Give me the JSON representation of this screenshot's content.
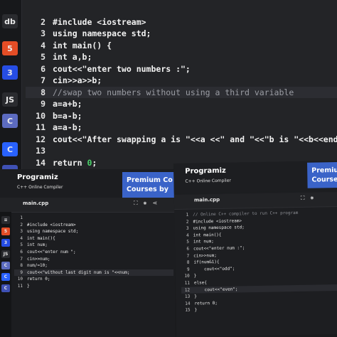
{
  "top_editor": {
    "sidebar_icons": [
      {
        "name": "database-icon",
        "bg": "#2a2b2f",
        "glyph": "db"
      },
      {
        "name": "html5-icon",
        "bg": "#e44d26",
        "glyph": "5"
      },
      {
        "name": "css3-icon",
        "bg": "#264de4",
        "glyph": "3"
      },
      {
        "name": "js-icon",
        "bg": "#2a2b2f",
        "glyph": "JS"
      },
      {
        "name": "c-lang-icon",
        "bg": "#5c6bc0",
        "glyph": "C"
      },
      {
        "name": "cpp-lang-icon",
        "bg": "#2962ff",
        "glyph": "C"
      },
      {
        "name": "csharp-icon",
        "bg": "#3f51b5",
        "glyph": "C#"
      }
    ],
    "lines": [
      {
        "num": "",
        "parts": [
          {
            "t": "",
            "c": ""
          }
        ]
      },
      {
        "num": "2",
        "parts": [
          {
            "t": "#include <iostream>",
            "c": ""
          }
        ]
      },
      {
        "num": "3",
        "parts": [
          {
            "t": "using namespace std;",
            "c": ""
          }
        ]
      },
      {
        "num": "4",
        "parts": [
          {
            "t": "int main() {",
            "c": ""
          }
        ]
      },
      {
        "num": "5",
        "parts": [
          {
            "t": "int a,b;",
            "c": ""
          }
        ]
      },
      {
        "num": "6",
        "parts": [
          {
            "t": "cout<<\"enter two numbers :\";",
            "c": ""
          }
        ]
      },
      {
        "num": "7",
        "parts": [
          {
            "t": "cin>>a>>b;",
            "c": ""
          }
        ]
      },
      {
        "num": "8",
        "parts": [
          {
            "t": "//swap two numbers without using a third variable",
            "c": "cmt"
          }
        ]
      },
      {
        "num": "9",
        "parts": [
          {
            "t": "a=a+b;",
            "c": ""
          }
        ]
      },
      {
        "num": "10",
        "parts": [
          {
            "t": "b=a-b;",
            "c": ""
          }
        ]
      },
      {
        "num": "11",
        "parts": [
          {
            "t": "a=a-b;",
            "c": ""
          }
        ]
      },
      {
        "num": "12",
        "parts": [
          {
            "t": "cout<<\"After swapping a is \"<<a <<\" and \"<<\"b is \"<<b<<endl;",
            "c": ""
          }
        ]
      },
      {
        "num": "13",
        "parts": [
          {
            "t": "",
            "c": ""
          }
        ]
      },
      {
        "num": "14",
        "parts": [
          {
            "t": "return ",
            "c": ""
          },
          {
            "t": "0",
            "c": "kw-green"
          },
          {
            "t": ";",
            "c": ""
          }
        ]
      },
      {
        "num": "15",
        "parts": [
          {
            "t": "}",
            "c": ""
          }
        ]
      }
    ]
  },
  "bottom_left": {
    "brand": "Programiz",
    "brand_sub": "C++ Online Compiler",
    "ad_line1": "Premium Co",
    "ad_line2": "Courses by",
    "file_tab": "main.cpp",
    "lines": [
      {
        "num": "1",
        "t": ""
      },
      {
        "num": "2",
        "t": "#include <iostream>"
      },
      {
        "num": "3",
        "t": "using namespace std;"
      },
      {
        "num": "4",
        "t": "int main(){"
      },
      {
        "num": "5",
        "t": "int num;"
      },
      {
        "num": "6",
        "t": "cout<<\"enter num \";"
      },
      {
        "num": "7",
        "t": "cin>>num;"
      },
      {
        "num": "8",
        "t": "num/=10;"
      },
      {
        "num": "9",
        "t": "cout<<\"without last digit num is \"<<num;"
      },
      {
        "num": "10",
        "t": "return 0;"
      },
      {
        "num": "11",
        "t": "}"
      }
    ]
  },
  "bottom_right": {
    "brand": "Programiz",
    "brand_sub": "C++ Online Compiler",
    "ad_line1": "Premiu",
    "ad_line2": "Course",
    "file_tab": "main.cpp",
    "lines": [
      {
        "num": "1",
        "t": "// Online C++ compiler to run C++ program"
      },
      {
        "num": "2",
        "t": "#include <iostream>"
      },
      {
        "num": "3",
        "t": "using namespace std;"
      },
      {
        "num": "4",
        "t": "int main(){"
      },
      {
        "num": "5",
        "t": "int num;"
      },
      {
        "num": "6",
        "t": "cout<<\"enter num :\";"
      },
      {
        "num": "7",
        "t": "cin>>num;"
      },
      {
        "num": "8",
        "t": "if(num&1){"
      },
      {
        "num": "9",
        "t": "    cout<<\"odd\";"
      },
      {
        "num": "10",
        "t": "}"
      },
      {
        "num": "11",
        "t": "else{"
      },
      {
        "num": "12",
        "t": "    cout<<\"even\";"
      },
      {
        "num": "13",
        "t": "}"
      },
      {
        "num": "14",
        "t": "return 0;"
      },
      {
        "num": "15",
        "t": "}"
      }
    ]
  }
}
